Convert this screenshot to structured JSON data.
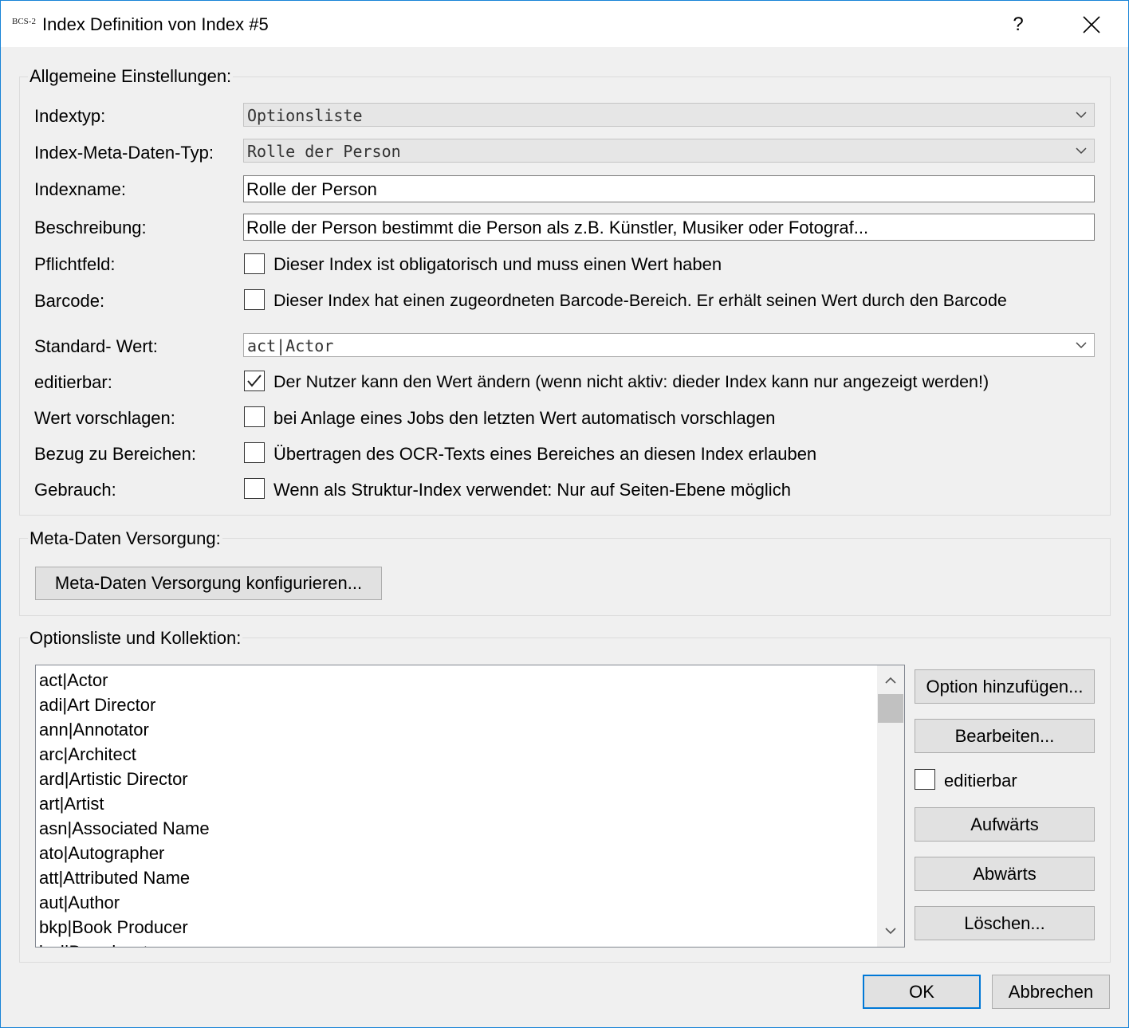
{
  "window": {
    "app_icon_text": "BCS-2",
    "title": "Index Definition von Index #5",
    "help_label": "?"
  },
  "general": {
    "title": "Allgemeine Einstellungen:",
    "indextyp_label": "Indextyp:",
    "indextyp_value": "Optionsliste",
    "meta_typ_label": "Index-Meta-Daten-Typ:",
    "meta_typ_value": "Rolle der Person",
    "indexname_label": "Indexname:",
    "indexname_value": "Rolle der Person",
    "beschreibung_label": "Beschreibung:",
    "beschreibung_value": "Rolle der Person bestimmt die Person als z.B. Künstler, Musiker oder Fotograf...",
    "pflichtfeld_label": "Pflichtfeld:",
    "pflichtfeld_text": "Dieser Index ist obligatorisch und muss einen Wert haben",
    "pflichtfeld_checked": false,
    "barcode_label": "Barcode:",
    "barcode_text": "Dieser Index hat einen zugeordneten Barcode-Bereich. Er erhält seinen Wert durch den Barcode",
    "barcode_checked": false,
    "standard_label": "Standard- Wert:",
    "standard_value": "act|Actor",
    "editierbar_label": "editierbar:",
    "editierbar_text": "Der Nutzer kann den Wert ändern (wenn nicht aktiv: dieder Index kann nur angezeigt werden!)",
    "editierbar_checked": true,
    "vorschlagen_label": "Wert vorschlagen:",
    "vorschlagen_text": "bei Anlage eines Jobs den letzten Wert automatisch vorschlagen",
    "vorschlagen_checked": false,
    "bezug_label": "Bezug zu Bereichen:",
    "bezug_text": "Übertragen des OCR-Texts eines Bereiches an diesen Index erlauben",
    "bezug_checked": false,
    "gebrauch_label": "Gebrauch:",
    "gebrauch_text": "Wenn als Struktur-Index verwendet: Nur auf Seiten-Ebene möglich",
    "gebrauch_checked": false
  },
  "meta": {
    "title": "Meta-Daten Versorgung:",
    "configure_label": "Meta-Daten Versorgung konfigurieren..."
  },
  "options": {
    "title": "Optionsliste und Kollektion:",
    "items": [
      "act|Actor",
      "adi|Art Director",
      "ann|Annotator",
      "arc|Architect",
      "ard|Artistic Director",
      "art|Artist",
      "asn|Associated Name",
      "ato|Autographer",
      "att|Attributed Name",
      "aut|Author",
      "bkp|Book Producer",
      "brd|Broadcaster"
    ],
    "add_label": "Option hinzufügen...",
    "edit_label": "Bearbeiten...",
    "editierbar_label": "editierbar",
    "editierbar_checked": false,
    "up_label": "Aufwärts",
    "down_label": "Abwärts",
    "delete_label": "Löschen..."
  },
  "footer": {
    "ok_label": "OK",
    "cancel_label": "Abbrechen"
  },
  "colors": {
    "window_border": "#1883d7",
    "dialog_bg": "#f0f0f0",
    "default_button_border": "#0078d7"
  }
}
